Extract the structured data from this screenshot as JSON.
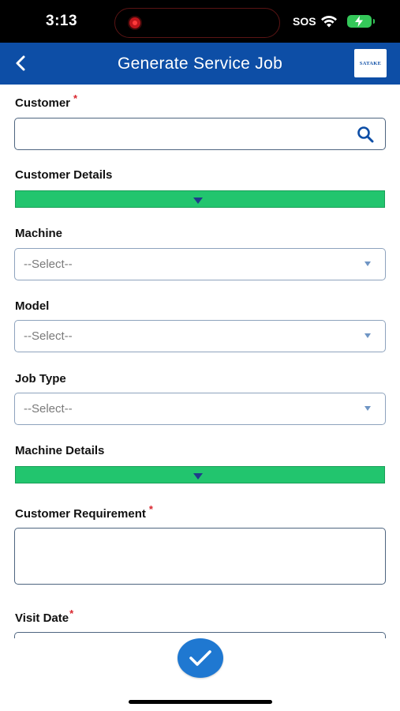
{
  "status_bar": {
    "time": "3:13",
    "sos": "SOS"
  },
  "header": {
    "title": "Generate Service Job",
    "brand": "SATAKE"
  },
  "form": {
    "customer": {
      "label": "Customer",
      "required_mark": "*",
      "value": ""
    },
    "customer_details": {
      "label": "Customer Details"
    },
    "machine": {
      "label": "Machine",
      "value": "--Select--"
    },
    "model": {
      "label": "Model",
      "value": "--Select--"
    },
    "job_type": {
      "label": "Job Type",
      "value": "--Select--"
    },
    "machine_details": {
      "label": "Machine Details"
    },
    "customer_requirement": {
      "label": "Customer Requirement",
      "required_mark": "*",
      "value": ""
    },
    "visit_date": {
      "label": "Visit Date",
      "required_mark": "*"
    }
  },
  "colors": {
    "header_bg": "#0d4ea6",
    "accordion_bg": "#22c56e",
    "required": "#d9262e",
    "submit_bg": "#1f78d1"
  },
  "icons": [
    "back-chevron-icon",
    "search-icon",
    "dropdown-caret-icon",
    "checkmark-icon",
    "wifi-icon",
    "battery-icon"
  ]
}
